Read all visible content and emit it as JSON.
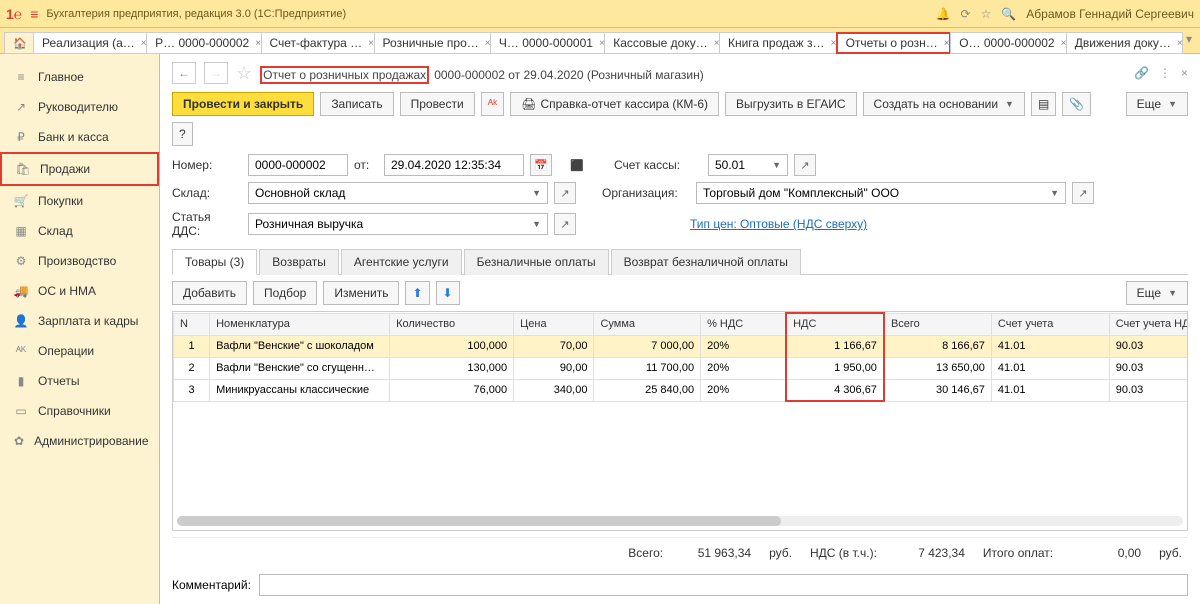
{
  "app": {
    "title": "Бухгалтерия предприятия, редакция 3.0   (1С:Предприятие)",
    "user": "Абрамов Геннадий Сергеевич"
  },
  "tabs": [
    {
      "label": "Реализация (а…"
    },
    {
      "label": "Р…  0000-000002"
    },
    {
      "label": "Счет-фактура …"
    },
    {
      "label": "Розничные про…"
    },
    {
      "label": "Ч…  0000-000001"
    },
    {
      "label": "Кассовые доку…"
    },
    {
      "label": "Книга продаж з…"
    },
    {
      "label": "Отчеты о розн…"
    },
    {
      "label": "О…  0000-000002"
    },
    {
      "label": "Движения доку…"
    }
  ],
  "sidebar": {
    "items": [
      {
        "label": "Главное",
        "icon": "≡"
      },
      {
        "label": "Руководителю",
        "icon": "↗"
      },
      {
        "label": "Банк и касса",
        "icon": "₽"
      },
      {
        "label": "Продажи",
        "icon": "🛍"
      },
      {
        "label": "Покупки",
        "icon": "🛒"
      },
      {
        "label": "Склад",
        "icon": "▦"
      },
      {
        "label": "Производство",
        "icon": "⚙"
      },
      {
        "label": "ОС и НМА",
        "icon": "🚚"
      },
      {
        "label": "Зарплата и кадры",
        "icon": "👤"
      },
      {
        "label": "Операции",
        "icon": "ᴬᴷ"
      },
      {
        "label": "Отчеты",
        "icon": "▮"
      },
      {
        "label": "Справочники",
        "icon": "▭"
      },
      {
        "label": "Администрирование",
        "icon": "✿"
      }
    ]
  },
  "doc": {
    "title_hl": "Отчет о розничных продажах",
    "title_rest": "0000-000002 от 29.04.2020 (Розничный магазин)"
  },
  "toolbar": {
    "save_close": "Провести и закрыть",
    "write": "Записать",
    "post": "Провести",
    "km6": "Справка-отчет кассира (КМ-6)",
    "egais": "Выгрузить в ЕГАИС",
    "create": "Создать на основании",
    "more": "Еще"
  },
  "form": {
    "number_lbl": "Номер:",
    "number": "0000-000002",
    "from_lbl": "от:",
    "date": "29.04.2020 12:35:34",
    "acc_lbl": "Счет кассы:",
    "acc": "50.01",
    "store_lbl": "Склад:",
    "store": "Основной склад",
    "org_lbl": "Организация:",
    "org": "Торговый дом \"Комплексный\" ООО",
    "dds_lbl": "Статья ДДС:",
    "dds": "Розничная выручка",
    "price_link": "Тип цен: Оптовые (НДС сверху)"
  },
  "subtabs": [
    "Товары (3)",
    "Возвраты",
    "Агентские услуги",
    "Безналичные оплаты",
    "Возврат безналичной оплаты"
  ],
  "subtool": {
    "add": "Добавить",
    "pick": "Подбор",
    "edit": "Изменить",
    "more": "Еще"
  },
  "table": {
    "cols": [
      "N",
      "Номенклатура",
      "Количество",
      "Цена",
      "Сумма",
      "% НДС",
      "НДС",
      "Всего",
      "Счет учета",
      "Счет учета НДС"
    ],
    "rows": [
      {
        "n": "1",
        "name": "Вафли \"Венские\" с шоколадом",
        "qty": "100,000",
        "price": "70,00",
        "sum": "7 000,00",
        "vatp": "20%",
        "vat": "1 166,67",
        "total": "8 166,67",
        "acc1": "41.01",
        "acc2": "90.03"
      },
      {
        "n": "2",
        "name": "Вафли \"Венские\" со сгущенн…",
        "qty": "130,000",
        "price": "90,00",
        "sum": "11 700,00",
        "vatp": "20%",
        "vat": "1 950,00",
        "total": "13 650,00",
        "acc1": "41.01",
        "acc2": "90.03"
      },
      {
        "n": "3",
        "name": "Миникруассаны классические",
        "qty": "76,000",
        "price": "340,00",
        "sum": "25 840,00",
        "vatp": "20%",
        "vat": "4 306,67",
        "total": "30 146,67",
        "acc1": "41.01",
        "acc2": "90.03"
      }
    ]
  },
  "totals": {
    "all_lbl": "Всего:",
    "all": "51 963,34",
    "rub": "руб.",
    "vat_lbl": "НДС (в т.ч.):",
    "vat": "7 423,34",
    "pay_lbl": "Итого оплат:",
    "pay": "0,00"
  },
  "comment_lbl": "Комментарий:"
}
